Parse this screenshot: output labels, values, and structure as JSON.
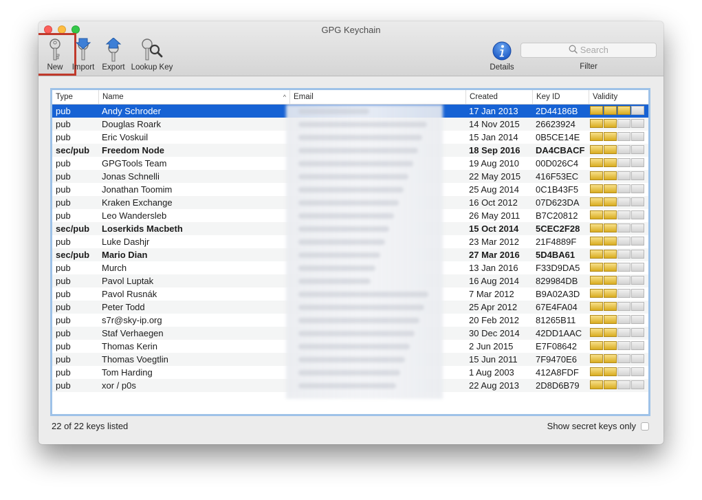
{
  "window": {
    "title": "GPG Keychain"
  },
  "toolbar": {
    "new_label": "New",
    "import_label": "Import",
    "export_label": "Export",
    "lookup_label": "Lookup Key",
    "details_label": "Details",
    "filter_label": "Filter",
    "search_placeholder": "Search"
  },
  "table": {
    "columns": [
      "Type",
      "Name",
      "Email",
      "Created",
      "Key ID",
      "Validity"
    ],
    "rows": [
      {
        "type": "pub",
        "name": "Andy Schroder",
        "created": "17 Jan 2013",
        "key_id": "2D44186B",
        "validity": 3,
        "selected": true,
        "bold": false
      },
      {
        "type": "pub",
        "name": "Douglas Roark",
        "created": "14 Nov 2015",
        "key_id": "26623924",
        "validity": 2,
        "selected": false,
        "bold": false
      },
      {
        "type": "pub",
        "name": "Eric Voskuil",
        "created": "15 Jan 2014",
        "key_id": "0B5CE14E",
        "validity": 2,
        "selected": false,
        "bold": false
      },
      {
        "type": "sec/pub",
        "name": "Freedom Node",
        "created": "18 Sep 2016",
        "key_id": "DA4CBACF",
        "validity": 2,
        "selected": false,
        "bold": true
      },
      {
        "type": "pub",
        "name": "GPGTools Team",
        "created": "19 Aug 2010",
        "key_id": "00D026C4",
        "validity": 2,
        "selected": false,
        "bold": false
      },
      {
        "type": "pub",
        "name": "Jonas Schnelli",
        "created": "22 May 2015",
        "key_id": "416F53EC",
        "validity": 2,
        "selected": false,
        "bold": false
      },
      {
        "type": "pub",
        "name": "Jonathan Toomim",
        "created": "25 Aug 2014",
        "key_id": "0C1B43F5",
        "validity": 2,
        "selected": false,
        "bold": false
      },
      {
        "type": "pub",
        "name": "Kraken Exchange",
        "created": "16 Oct 2012",
        "key_id": "07D623DA",
        "validity": 2,
        "selected": false,
        "bold": false
      },
      {
        "type": "pub",
        "name": "Leo Wandersleb",
        "created": "26 May 2011",
        "key_id": "B7C20812",
        "validity": 2,
        "selected": false,
        "bold": false
      },
      {
        "type": "sec/pub",
        "name": "Loserkids Macbeth",
        "created": "15 Oct 2014",
        "key_id": "5CEC2F28",
        "validity": 2,
        "selected": false,
        "bold": true
      },
      {
        "type": "pub",
        "name": "Luke Dashjr",
        "created": "23 Mar 2012",
        "key_id": "21F4889F",
        "validity": 2,
        "selected": false,
        "bold": false
      },
      {
        "type": "sec/pub",
        "name": "Mario Dian",
        "created": "27 Mar 2016",
        "key_id": "5D4BA61",
        "validity": 2,
        "selected": false,
        "bold": true
      },
      {
        "type": "pub",
        "name": "Murch",
        "created": "13 Jan 2016",
        "key_id": "F33D9DA5",
        "validity": 2,
        "selected": false,
        "bold": false
      },
      {
        "type": "pub",
        "name": "Pavol Luptak",
        "created": "16 Aug 2014",
        "key_id": "829984DB",
        "validity": 2,
        "selected": false,
        "bold": false
      },
      {
        "type": "pub",
        "name": "Pavol Rusnák",
        "created": "7 Mar 2012",
        "key_id": "B9A02A3D",
        "validity": 2,
        "selected": false,
        "bold": false
      },
      {
        "type": "pub",
        "name": "Peter Todd",
        "created": "25 Apr 2012",
        "key_id": "67E4FA04",
        "validity": 2,
        "selected": false,
        "bold": false
      },
      {
        "type": "pub",
        "name": "s7r@sky-ip.org",
        "created": "20 Feb 2012",
        "key_id": "81265B11",
        "validity": 2,
        "selected": false,
        "bold": false
      },
      {
        "type": "pub",
        "name": "Staf Verhaegen",
        "created": "30 Dec 2014",
        "key_id": "42DD1AAC",
        "validity": 2,
        "selected": false,
        "bold": false
      },
      {
        "type": "pub",
        "name": "Thomas Kerin",
        "created": "2 Jun 2015",
        "key_id": "E7F08642",
        "validity": 2,
        "selected": false,
        "bold": false
      },
      {
        "type": "pub",
        "name": "Thomas Voegtlin",
        "created": "15 Jun 2011",
        "key_id": "7F9470E6",
        "validity": 2,
        "selected": false,
        "bold": false
      },
      {
        "type": "pub",
        "name": "Tom Harding",
        "created": "1 Aug 2003",
        "key_id": "412A8FDF",
        "validity": 2,
        "selected": false,
        "bold": false
      },
      {
        "type": "pub",
        "name": "xor / p0s",
        "created": "22 Aug 2013",
        "key_id": "2D8D6B79",
        "validity": 2,
        "selected": false,
        "bold": false
      }
    ]
  },
  "footer": {
    "status": "22 of 22 keys listed",
    "secret_only_label": "Show secret keys only"
  },
  "colors": {
    "selection": "#1662d4",
    "validity_on": "#e8c23c",
    "focus_ring": "#9ec2e8",
    "highlight_annotation": "#c0392b"
  },
  "icons": {
    "new": "key-icon",
    "import": "key-import-icon",
    "export": "key-export-icon",
    "lookup": "key-search-icon",
    "details": "info-icon",
    "search": "magnifier-icon"
  }
}
